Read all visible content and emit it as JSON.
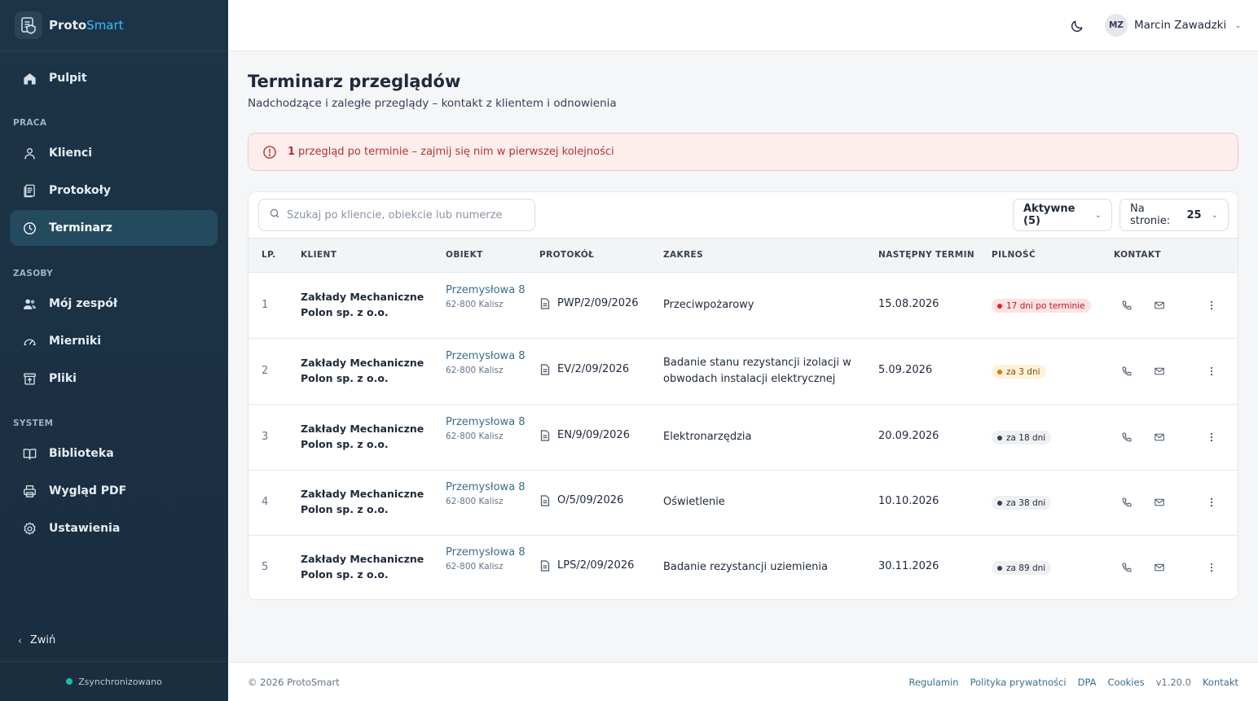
{
  "brand": {
    "name_part1": "Proto",
    "name_part2": "Smart"
  },
  "sidebar": {
    "dashboard": "Pulpit",
    "sections": {
      "work": "PRACA",
      "resources": "ZASOBY",
      "system": "SYSTEM"
    },
    "items": {
      "clients": "Klienci",
      "protocols": "Protokoły",
      "schedule": "Terminarz",
      "team": "Mój zespół",
      "meters": "Mierniki",
      "files": "Pliki",
      "library": "Biblioteka",
      "pdf": "Wygląd PDF",
      "settings": "Ustawienia"
    },
    "collapse": "Zwiń",
    "sync_status": "Zsynchronizowano"
  },
  "user": {
    "initials": "MZ",
    "name": "Marcin Zawadzki"
  },
  "page": {
    "title": "Terminarz przeglądów",
    "subtitle": "Nadchodzące i zaległe przeglądy – kontakt z klientem i odnowienia"
  },
  "alert": {
    "count": "1",
    "text": "przegląd po terminie – zajmij się nim w pierwszej kolejności"
  },
  "toolbar": {
    "search_placeholder": "Szukaj po kliencie, obiekcie lub numerze",
    "filter_label": "Aktywne (5)",
    "per_page_label": "Na stronie:",
    "per_page_value": "25"
  },
  "table": {
    "headers": [
      "LP.",
      "KLIENT",
      "OBIEKT",
      "PROTOKÓŁ",
      "ZAKRES",
      "NASTĘPNY TERMIN",
      "PILNOŚĆ",
      "KONTAKT"
    ],
    "rows": [
      {
        "lp": "1",
        "client": "Zakłady Mechaniczne Polon sp. z o.o.",
        "street": "Przemysłowa 8",
        "city": "62-800 Kalisz",
        "protocol": "PWP/2/09/2026",
        "scope": "Przeciwpożarowy",
        "date": "15.08.2026",
        "urgency": "17 dni po terminie",
        "urgency_level": "overdue"
      },
      {
        "lp": "2",
        "client": "Zakłady Mechaniczne Polon sp. z o.o.",
        "street": "Przemysłowa 8",
        "city": "62-800 Kalisz",
        "protocol": "EV/2/09/2026",
        "scope": "Badanie stanu rezystancji izolacji w obwodach instalacji elektrycznej",
        "date": "5.09.2026",
        "urgency": "za 3 dni",
        "urgency_level": "soon"
      },
      {
        "lp": "3",
        "client": "Zakłady Mechaniczne Polon sp. z o.o.",
        "street": "Przemysłowa 8",
        "city": "62-800 Kalisz",
        "protocol": "EN/9/09/2026",
        "scope": "Elektronarzędzia",
        "date": "20.09.2026",
        "urgency": "za 18 dni",
        "urgency_level": "normal"
      },
      {
        "lp": "4",
        "client": "Zakłady Mechaniczne Polon sp. z o.o.",
        "street": "Przemysłowa 8",
        "city": "62-800 Kalisz",
        "protocol": "O/5/09/2026",
        "scope": "Oświetlenie",
        "date": "10.10.2026",
        "urgency": "za 38 dni",
        "urgency_level": "normal"
      },
      {
        "lp": "5",
        "client": "Zakłady Mechaniczne Polon sp. z o.o.",
        "street": "Przemysłowa 8",
        "city": "62-800 Kalisz",
        "protocol": "LPS/2/09/2026",
        "scope": "Badanie rezystancji uziemienia",
        "date": "30.11.2026",
        "urgency": "za 89 dni",
        "urgency_level": "normal"
      }
    ]
  },
  "footer": {
    "copyright": "© 2026 ProtoSmart",
    "links": [
      "Regulamin",
      "Polityka prywatności",
      "DPA",
      "Cookies"
    ],
    "version": "v1.20.0",
    "contact": "Kontakt"
  },
  "colors": {
    "sidebar_bg": "#1c3447",
    "active_item": "#244a5e",
    "accent": "#38bdf8",
    "alert_bg": "#fdeeee",
    "alert_text": "#b4332f",
    "overdue_bg": "#fde2e2",
    "overdue_dot": "#dc2626",
    "soon_bg": "#fdf3d8",
    "soon_dot": "#d97706",
    "normal_bg": "#eef0f3",
    "normal_dot": "#334155"
  },
  "icons": {
    "dashboard": "home-icon",
    "clients": "user-icon",
    "protocols": "document-icon",
    "schedule": "clock-icon",
    "team": "users-icon",
    "meters": "gauge-icon",
    "files": "archive-icon",
    "library": "book-icon",
    "pdf": "printer-icon",
    "settings": "gear-icon",
    "theme": "moon-icon",
    "phone": "phone-icon",
    "mail": "mail-icon",
    "more": "more-vertical-icon",
    "search": "search-icon",
    "alert": "alert-circle-icon"
  }
}
